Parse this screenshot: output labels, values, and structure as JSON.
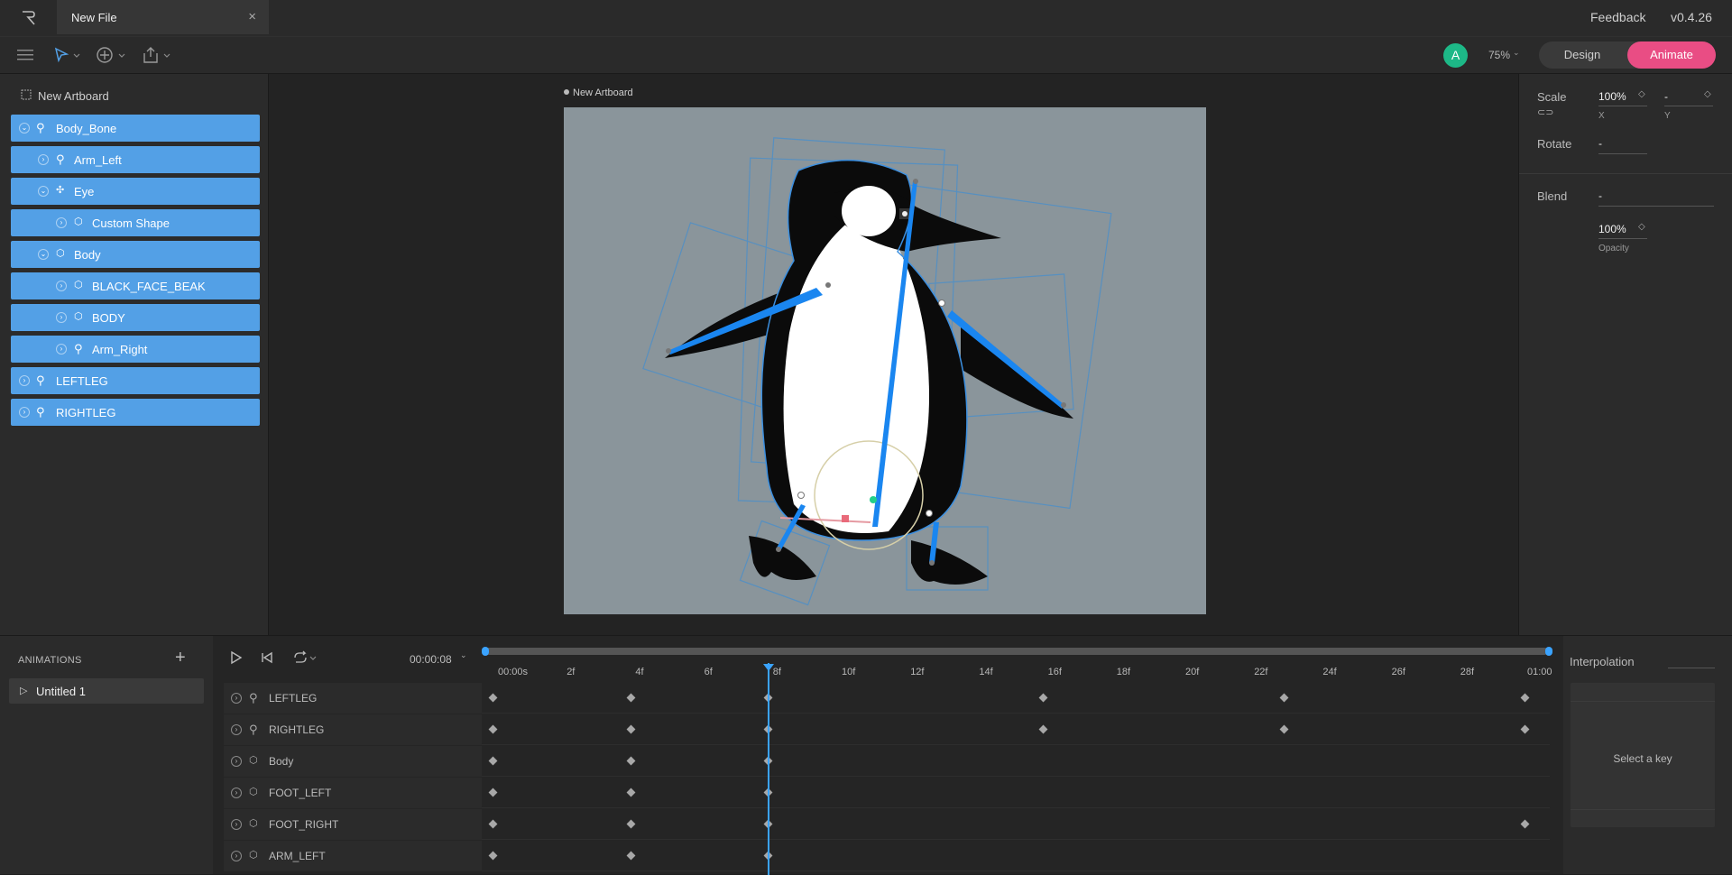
{
  "titlebar": {
    "file_tab": "New File",
    "close": "×",
    "feedback": "Feedback",
    "version": "v0.4.26"
  },
  "toolbar": {
    "avatar": "A",
    "zoom": "75%",
    "design": "Design",
    "animate": "Animate"
  },
  "hierarchy": {
    "artboard": "New Artboard",
    "items": [
      {
        "label": "Body_Bone"
      },
      {
        "label": "Arm_Left"
      },
      {
        "label": "Eye"
      },
      {
        "label": "Custom Shape"
      },
      {
        "label": "Body"
      },
      {
        "label": "BLACK_FACE_BEAK"
      },
      {
        "label": "BODY"
      },
      {
        "label": "Arm_Right"
      },
      {
        "label": "LEFTLEG"
      },
      {
        "label": "RIGHTLEG"
      }
    ]
  },
  "stage": {
    "artboard_label": "New Artboard"
  },
  "inspector": {
    "scale_label": "Scale",
    "scale_x": "100%",
    "scale_y": "-",
    "x": "X",
    "y": "Y",
    "rotate_label": "Rotate",
    "rotate_val": "-",
    "blend_label": "Blend",
    "blend_val": "-",
    "opacity_val": "100%",
    "opacity_label": "Opacity"
  },
  "animations": {
    "title": "ANIMATIONS",
    "add": "+",
    "items": [
      {
        "label": "Untitled 1"
      }
    ]
  },
  "timeline": {
    "time": "00:00:08",
    "ticks": [
      "00:00s",
      "2f",
      "4f",
      "6f",
      "8f",
      "10f",
      "12f",
      "14f",
      "16f",
      "18f",
      "20f",
      "22f",
      "24f",
      "26f",
      "28f",
      "01:00"
    ],
    "rows": [
      {
        "label": "LEFTLEG"
      },
      {
        "label": "RIGHTLEG"
      },
      {
        "label": "Body"
      },
      {
        "label": "FOOT_LEFT"
      },
      {
        "label": "FOOT_RIGHT"
      },
      {
        "label": "ARM_LEFT"
      }
    ]
  },
  "interpolation": {
    "title": "Interpolation",
    "placeholder": "Select a key"
  },
  "colors": {
    "accent": "#53a0e6",
    "animate": "#e94d84",
    "avatar": "#1db887",
    "playhead": "#3aa3ff"
  }
}
